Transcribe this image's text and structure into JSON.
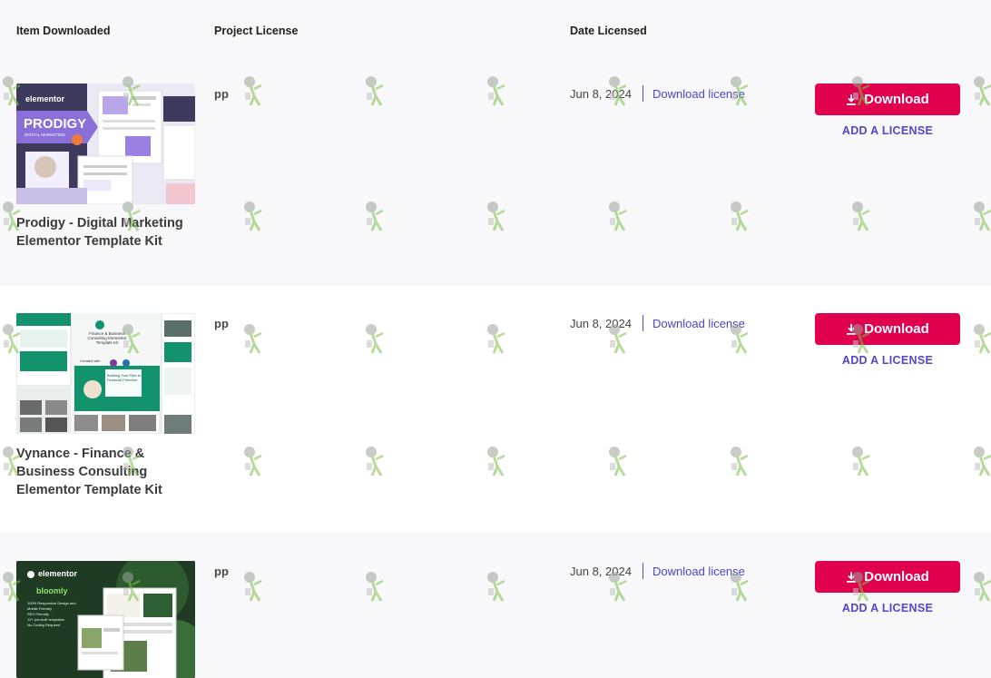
{
  "headers": {
    "item": "Item Downloaded",
    "project": "Project License",
    "date": "Date Licensed"
  },
  "rows": [
    {
      "title_line1": "Prodigy - Digital Marketing",
      "title_line2": "Elementor Template Kit",
      "title_line3": "",
      "thumb_brand": "elementor",
      "thumb_heading": "PRODIGY",
      "thumb_sub": "DIGITAL MARKETING",
      "project": "pp",
      "date": "Jun 8, 2024",
      "license_link": "Download license",
      "download_label": "Download",
      "add_license_label": "ADD A LICENSE"
    },
    {
      "title_line1": "Vynance - Finance &",
      "title_line2": "Business Consulting",
      "title_line3": "Elementor Template Kit",
      "thumb_heading": "Finance & Business Consulting Elementor Template Kit",
      "thumb_created": "Created with",
      "thumb_card": "Building Your Path to Financial Freedom",
      "project": "pp",
      "date": "Jun 8, 2024",
      "license_link": "Download license",
      "download_label": "Download",
      "add_license_label": "ADD A LICENSE"
    },
    {
      "title_line1": "",
      "title_line2": "",
      "title_line3": "",
      "thumb_brand": "elementor",
      "thumb_logo": "bloomly",
      "thumb_features": [
        "100% Responsive Design and Mobile Friendly",
        "SEO Friendly",
        "12+ pre-built templates",
        "No Coding Required"
      ],
      "project": "pp",
      "date": "Jun 8, 2024",
      "license_link": "Download license",
      "download_label": "Download",
      "add_license_label": "ADD A LICENSE"
    }
  ],
  "colors": {
    "download_button": "#e0004d",
    "link": "#4a45c9",
    "row_alt": "#f8f8fa"
  },
  "icons": {
    "download": "download-arrow-icon",
    "watermark": "watermark-figure-icon"
  }
}
